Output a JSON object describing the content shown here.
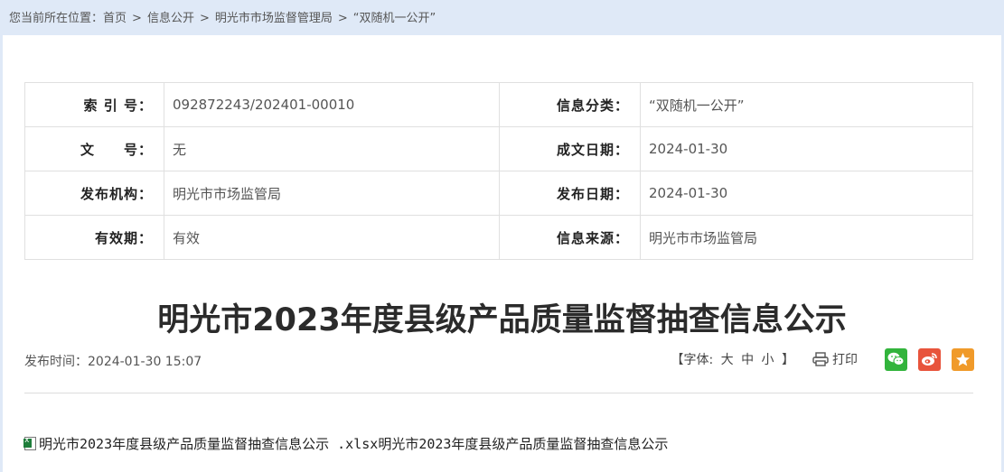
{
  "breadcrumb": {
    "prefix": "您当前所在位置：",
    "items": [
      "首页",
      "信息公开",
      "明光市市场监督管理局",
      "“双随机一公开”"
    ],
    "separator": ">"
  },
  "meta": {
    "index_no_label": "索 引 号：",
    "index_no_value": "092872243/202401-00010",
    "category_label": "信息分类：",
    "category_value": "“双随机一公开”",
    "doc_no_label": "文　　号：",
    "doc_no_value": "无",
    "created_label": "成文日期：",
    "created_value": "2024-01-30",
    "publisher_label": "发布机构：",
    "publisher_value": "明光市市场监管局",
    "published_label": "发布日期：",
    "published_value": "2024-01-30",
    "validity_label": "有效期：",
    "validity_value": "有效",
    "source_label": "信息来源：",
    "source_value": "明光市市场监管局"
  },
  "article": {
    "title": "明光市2023年度县级产品质量监督抽查信息公示",
    "publish_time": "发布时间：2024-01-30 15:07"
  },
  "tools": {
    "font_prefix": "【字体:",
    "font_large": "大",
    "font_medium": "中",
    "font_small": "小",
    "font_suffix": "】",
    "print_label": "打印"
  },
  "attachment": {
    "icon": "excel-file-icon",
    "link_text": "明光市2023年度县级产品质量监督抽查信息公示 .xlsx",
    "trailing_text": "明光市2023年度县级产品质量监督抽查信息公示"
  },
  "colors": {
    "page_bg": "#dfe9f7",
    "wechat": "#32b43c",
    "weibo": "#e8543c",
    "favorite": "#f09a2a"
  }
}
